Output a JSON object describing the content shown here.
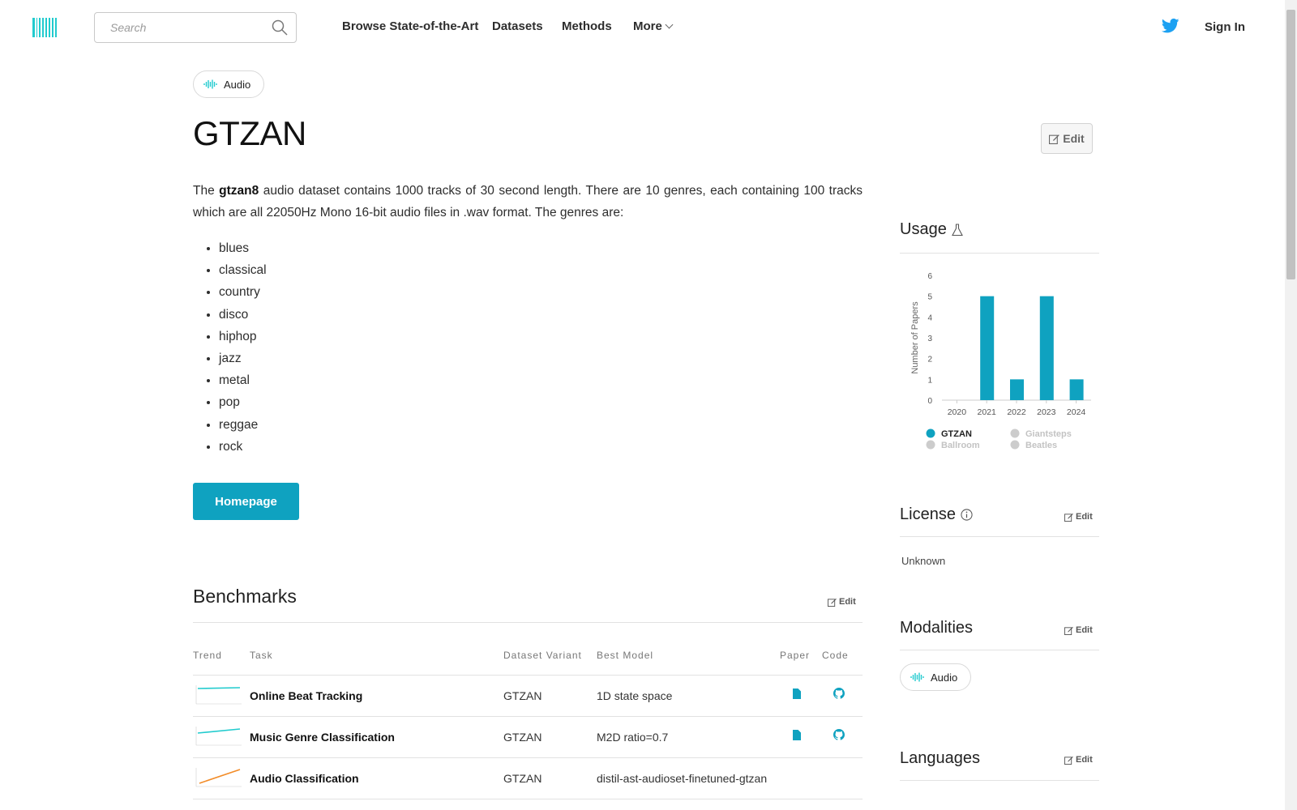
{
  "header": {
    "search_placeholder": "Search",
    "nav": [
      "Browse State-of-the-Art",
      "Datasets",
      "Methods",
      "More"
    ],
    "sign_in": "Sign In"
  },
  "dataset": {
    "modality_tag": "Audio",
    "title": "GTZAN",
    "edit_label": "Edit",
    "desc_prefix": "The ",
    "desc_bold": "gtzan8",
    "desc_rest": " audio dataset contains 1000 tracks of 30 second length. There are 10 genres, each containing 100 tracks which are all 22050Hz Mono 16-bit audio files in .wav format. The genres are:",
    "genres": [
      "blues",
      "classical",
      "country",
      "disco",
      "hiphop",
      "jazz",
      "metal",
      "pop",
      "reggae",
      "rock"
    ],
    "homepage_label": "Homepage"
  },
  "benchmarks": {
    "heading": "Benchmarks",
    "edit_label": "Edit",
    "columns": [
      "Trend",
      "Task",
      "Dataset Variant",
      "Best Model",
      "Paper",
      "Code"
    ],
    "rows": [
      {
        "task": "Online Beat Tracking",
        "variant": "GTZAN",
        "model": "1D state space",
        "has_paper": true,
        "has_code": true
      },
      {
        "task": "Music Genre Classification",
        "variant": "GTZAN",
        "model": "M2D ratio=0.7",
        "has_paper": true,
        "has_code": true
      },
      {
        "task": "Audio Classification",
        "variant": "GTZAN",
        "model": "distil-ast-audioset-finetuned-gtzan",
        "has_paper": false,
        "has_code": false
      }
    ]
  },
  "sidebar": {
    "usage_heading": "Usage",
    "license_heading": "License",
    "license_value": "Unknown",
    "modalities_heading": "Modalities",
    "modality": "Audio",
    "languages_heading": "Languages",
    "edit_label": "Edit"
  },
  "colors": {
    "accent": "#0fa2c0",
    "logo": "#21cbce",
    "legend_inactive": "#cccccc"
  },
  "chart_data": {
    "type": "bar",
    "categories": [
      "2020",
      "2021",
      "2022",
      "2023",
      "2024"
    ],
    "series": [
      {
        "name": "GTZAN",
        "values": [
          0,
          5,
          1,
          5,
          1
        ],
        "active": true
      },
      {
        "name": "Giantsteps",
        "values": [],
        "active": false
      },
      {
        "name": "Ballroom",
        "values": [],
        "active": false
      },
      {
        "name": "Beatles",
        "values": [],
        "active": false
      }
    ],
    "ylabel": "Number of Papers",
    "xlabel": "",
    "ylim": [
      0,
      6
    ],
    "yticks": [
      "0",
      "1",
      "2",
      "3",
      "4",
      "5",
      "6"
    ],
    "legend_position": "bottom"
  }
}
